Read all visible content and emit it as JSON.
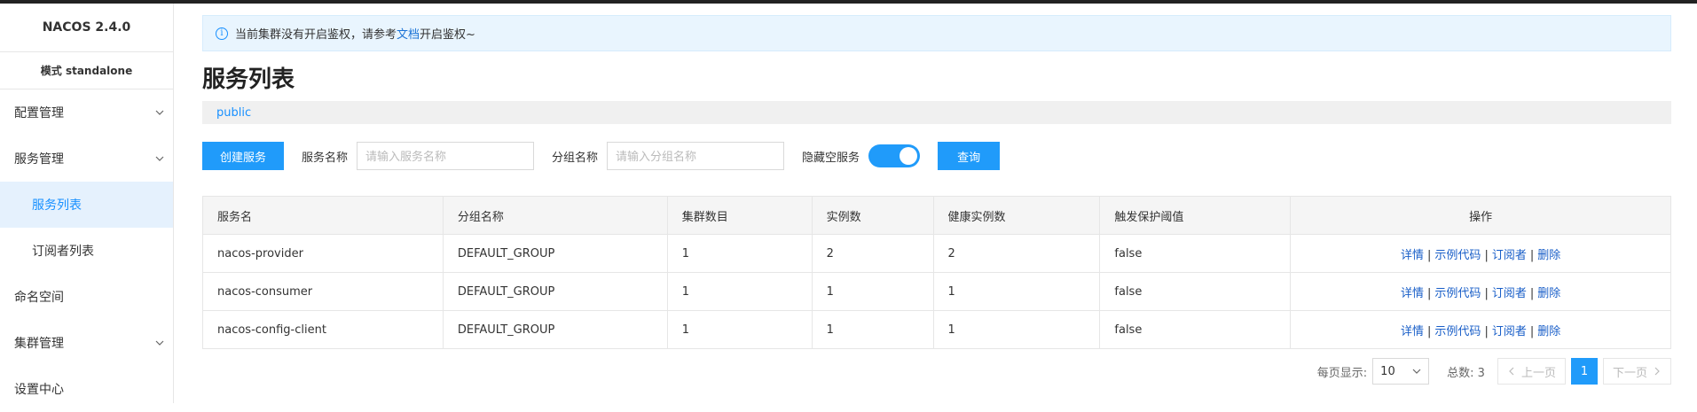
{
  "sidebar": {
    "brand": "NACOS 2.4.0",
    "mode": "模式 standalone",
    "items": [
      {
        "label": "配置管理"
      },
      {
        "label": "服务管理"
      },
      {
        "label": "服务列表"
      },
      {
        "label": "订阅者列表"
      },
      {
        "label": "命名空间"
      },
      {
        "label": "集群管理"
      },
      {
        "label": "设置中心"
      }
    ]
  },
  "alert": {
    "icon": "info-icon",
    "text_before": "当前集群没有开启鉴权，请参考",
    "link": "文档",
    "text_after": "开启鉴权~"
  },
  "page_title": "服务列表",
  "namespace": "public",
  "filters": {
    "create_label": "创建服务",
    "service_name_label": "服务名称",
    "service_name_placeholder": "请输入服务名称",
    "group_name_label": "分组名称",
    "group_name_placeholder": "请输入分组名称",
    "hide_empty_label": "隐藏空服务",
    "hide_empty_on": true,
    "query_label": "查询"
  },
  "table": {
    "headers": [
      "服务名",
      "分组名称",
      "集群数目",
      "实例数",
      "健康实例数",
      "触发保护阈值",
      "操作"
    ],
    "rows": [
      [
        "nacos-provider",
        "DEFAULT_GROUP",
        "1",
        "2",
        "2",
        "false"
      ],
      [
        "nacos-consumer",
        "DEFAULT_GROUP",
        "1",
        "1",
        "1",
        "false"
      ],
      [
        "nacos-config-client",
        "DEFAULT_GROUP",
        "1",
        "1",
        "1",
        "false"
      ]
    ],
    "actions": {
      "detail": "详情",
      "sample": "示例代码",
      "subscriber": "订阅者",
      "delete": "删除",
      "sep": "|"
    }
  },
  "pager": {
    "page_size_label": "每页显示:",
    "page_size": "10",
    "total_label": "总数: 3",
    "prev": "上一页",
    "current": "1",
    "next": "下一页"
  },
  "colors": {
    "primary": "#209bfa",
    "link": "#1a5fc8",
    "alert_bg": "#e9f5fe"
  }
}
